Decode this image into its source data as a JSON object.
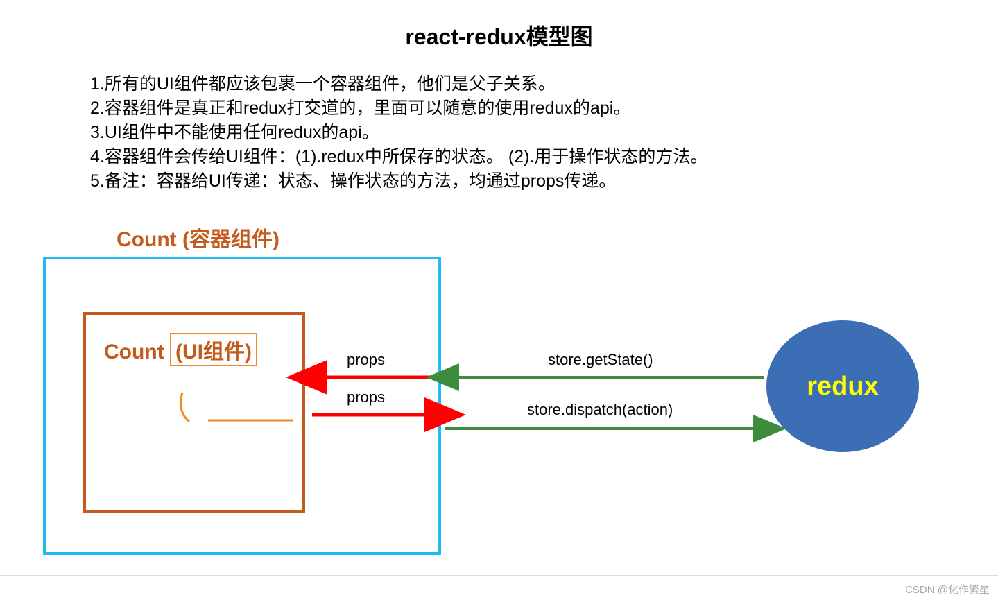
{
  "title": "react-redux模型图",
  "notes": [
    "1.所有的UI组件都应该包裹一个容器组件，他们是父子关系。",
    "2.容器组件是真正和redux打交道的，里面可以随意的使用redux的api。",
    "3.UI组件中不能使用任何redux的api。",
    "4.容器组件会传给UI组件：(1).redux中所保存的状态。  (2).用于操作状态的方法。",
    "5.备注：容器给UI传递：状态、操作状态的方法，均通过props传递。"
  ],
  "container_label": "Count (容器组件)",
  "ui_label_part1": "Count ",
  "ui_label_part2": "(UI组件)",
  "redux_label": "redux",
  "arrows": {
    "props_top": "props",
    "props_bottom": "props",
    "get_state": "store.getState()",
    "dispatch": "store.dispatch(action)"
  },
  "watermark": "CSDN @化作繁星",
  "colors": {
    "container_border": "#1fbbf1",
    "ui_border": "#c45a1c",
    "ui_highlight": "#ed8b24",
    "red_arrow": "#ff0000",
    "green_arrow": "#3d8c3d",
    "redux_bg": "#3b6eb4",
    "redux_text": "#ffff00"
  }
}
